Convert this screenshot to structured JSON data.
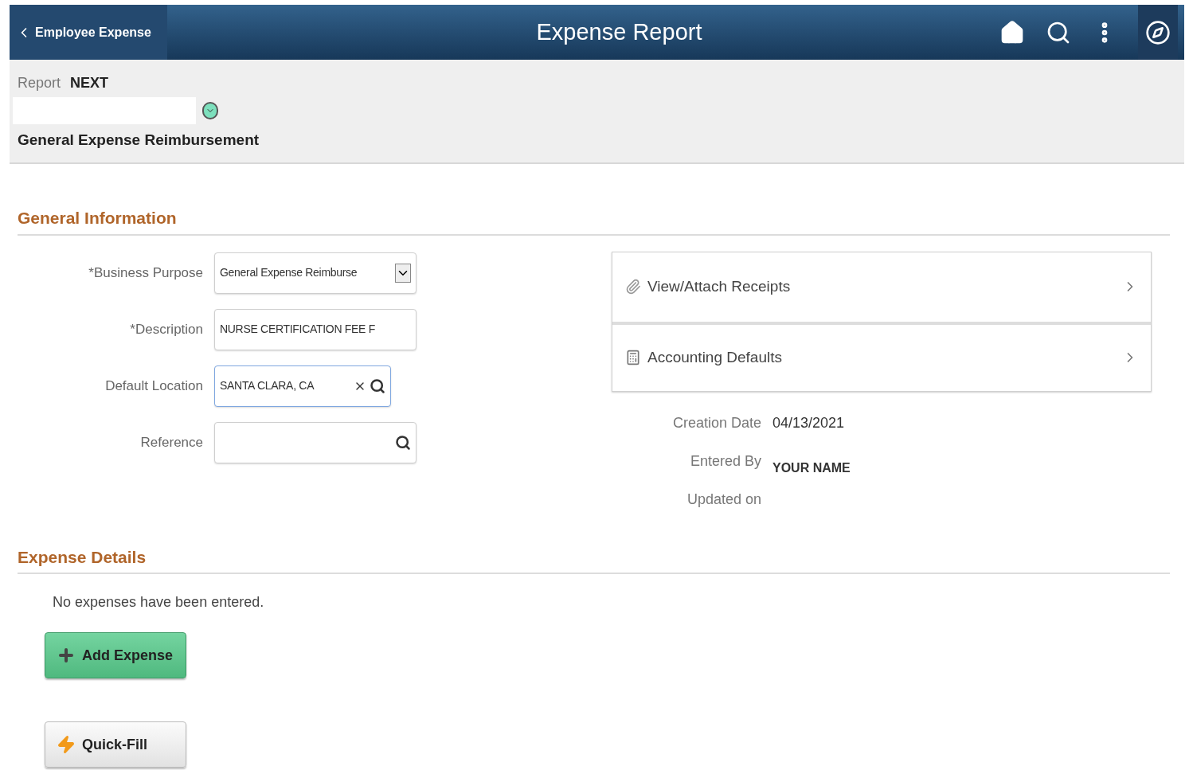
{
  "header": {
    "back_label": "Employee Expense",
    "title": "Expense Report"
  },
  "report": {
    "label": "Report",
    "value": "NEXT",
    "name": "General Expense Reimbursement"
  },
  "general_information": {
    "title": "General Information",
    "fields": [
      {
        "label": "*Business Purpose",
        "kind": "select",
        "value": "General Expense Reimburse",
        "focused": false
      },
      {
        "label": "*Description",
        "kind": "text",
        "value": "NURSE CERTIFICATION FEE F",
        "focused": false
      },
      {
        "label": "Default Location",
        "kind": "lookup_clear",
        "value": "SANTA CLARA, CA",
        "focused": true
      },
      {
        "label": "Reference",
        "kind": "lookup",
        "focused": false
      }
    ],
    "links": [
      {
        "kind": "attachment",
        "label": "View/Attach Receipts"
      },
      {
        "kind": "accounting",
        "label": "Accounting Defaults"
      }
    ],
    "info": [
      {
        "label": "Creation Date",
        "value": "04/13/2021"
      },
      {
        "label": "Entered By",
        "value": "YOUR NAME"
      },
      {
        "label": "Updated on"
      }
    ]
  },
  "expense_details": {
    "title": "Expense Details",
    "message": "No expenses have been entered.",
    "buttons": [
      {
        "kind": "add",
        "label": "Add Expense"
      },
      {
        "kind": "quickfill",
        "label": "Quick-Fill"
      }
    ]
  }
}
